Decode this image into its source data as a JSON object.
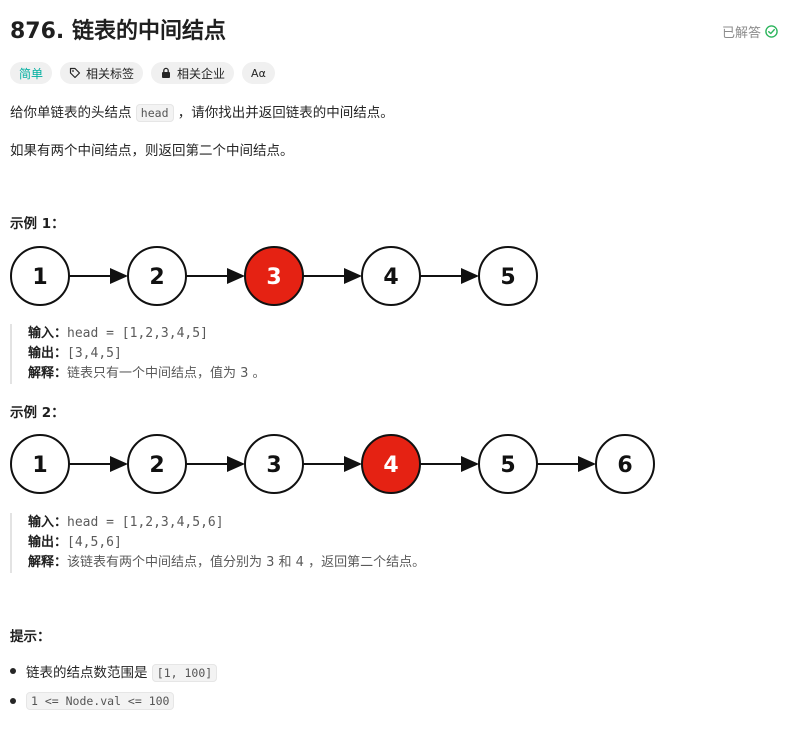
{
  "problem": {
    "title": "876. 链表的中间结点",
    "status": "已解答"
  },
  "tags": {
    "difficulty": "简单",
    "topics": "相关标签",
    "companies": "相关企业",
    "translate": "Aα"
  },
  "description": {
    "p1_before": "给你单链表的头结点",
    "p1_code": "head",
    "p1_after": "，请你找出并返回链表的中间结点。",
    "p2": "如果有两个中间结点，则返回第二个中间结点。"
  },
  "examples": [
    {
      "title": "示例 1：",
      "nodes": [
        "1",
        "2",
        "3",
        "4",
        "5"
      ],
      "highlight_index": 2,
      "input_label": "输入：",
      "input": "head = [1,2,3,4,5]",
      "output_label": "输出：",
      "output": "[3,4,5]",
      "explain_label": "解释：",
      "explain": "链表只有一个中间结点，值为 3 。"
    },
    {
      "title": "示例 2：",
      "nodes": [
        "1",
        "2",
        "3",
        "4",
        "5",
        "6"
      ],
      "highlight_index": 3,
      "input_label": "输入：",
      "input": "head = [1,2,3,4,5,6]",
      "output_label": "输出：",
      "output": "[4,5,6]",
      "explain_label": "解释：",
      "explain": "该链表有两个中间结点，值分别为 3 和 4 ，返回第二个结点。"
    }
  ],
  "hints": {
    "title": "提示：",
    "items": [
      "[1, 100]",
      "1 <= Node.val <= 100"
    ],
    "item1_prefix": "链表的结点数范围是"
  },
  "colors": {
    "highlight": "#e52213",
    "easy": "#00afa0",
    "solved": "#2db55d"
  }
}
